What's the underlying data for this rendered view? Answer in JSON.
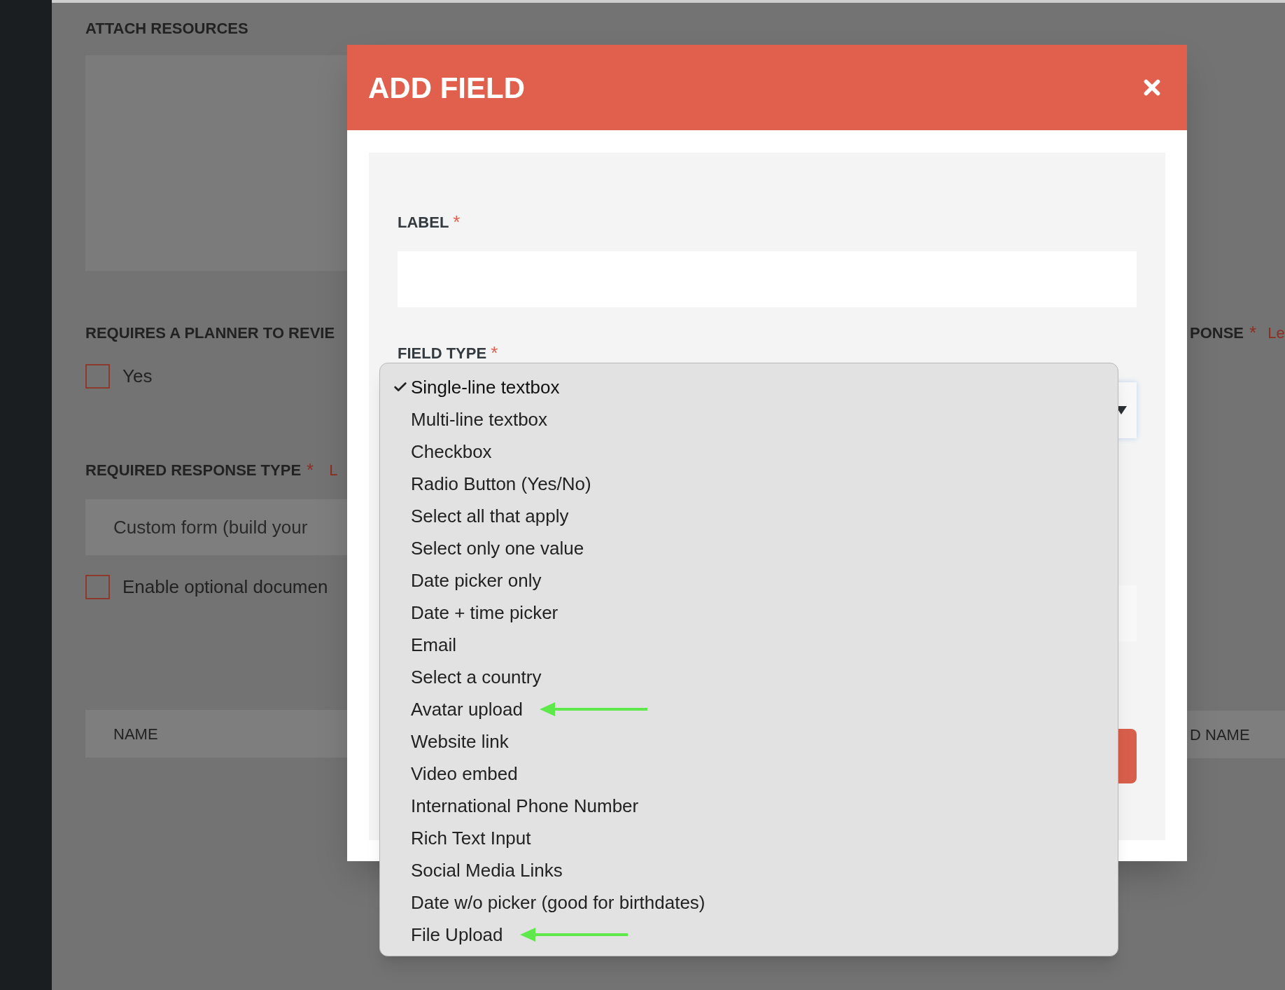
{
  "page": {
    "attach_resources": {
      "title": "ATTACH RESOURCES"
    },
    "review": {
      "title": "REQUIRES A PLANNER TO REVIE",
      "checkbox": {
        "label": "Yes",
        "checked": false
      }
    },
    "response_type": {
      "title": "REQUIRED RESPONSE TYPE",
      "required_mark": "*",
      "link": "L",
      "select_value": "Custom form (build your",
      "checkbox": {
        "label": "Enable optional documen",
        "checked": false
      }
    },
    "table_header": {
      "column_1": "NAME"
    },
    "right_column": {
      "title": "PONSE",
      "required_mark": "*",
      "link": "Le",
      "table_header": "D NAME"
    }
  },
  "dialog": {
    "title": "ADD FIELD",
    "label_field": {
      "label": "LABEL",
      "required_mark": "*"
    },
    "field_type": {
      "label": "FIELD TYPE",
      "required_mark": "*"
    },
    "dropdown": {
      "options": [
        {
          "label": "Single-line textbox",
          "selected": true,
          "annotated": false
        },
        {
          "label": "Multi-line textbox",
          "selected": false,
          "annotated": false
        },
        {
          "label": "Checkbox",
          "selected": false,
          "annotated": false
        },
        {
          "label": "Radio Button (Yes/No)",
          "selected": false,
          "annotated": false
        },
        {
          "label": "Select all that apply",
          "selected": false,
          "annotated": false
        },
        {
          "label": "Select only one value",
          "selected": false,
          "annotated": false
        },
        {
          "label": "Date picker only",
          "selected": false,
          "annotated": false
        },
        {
          "label": "Date + time picker",
          "selected": false,
          "annotated": false
        },
        {
          "label": "Email",
          "selected": false,
          "annotated": false
        },
        {
          "label": "Select a country",
          "selected": false,
          "annotated": false
        },
        {
          "label": "Avatar upload",
          "selected": false,
          "annotated": true
        },
        {
          "label": "Website link",
          "selected": false,
          "annotated": false
        },
        {
          "label": "Video embed",
          "selected": false,
          "annotated": false
        },
        {
          "label": "International Phone Number",
          "selected": false,
          "annotated": false
        },
        {
          "label": "Rich Text Input",
          "selected": false,
          "annotated": false
        },
        {
          "label": "Social Media Links",
          "selected": false,
          "annotated": false
        },
        {
          "label": "Date w/o picker (good for birthdates)",
          "selected": false,
          "annotated": false
        },
        {
          "label": "File Upload",
          "selected": false,
          "annotated": true
        }
      ]
    }
  }
}
